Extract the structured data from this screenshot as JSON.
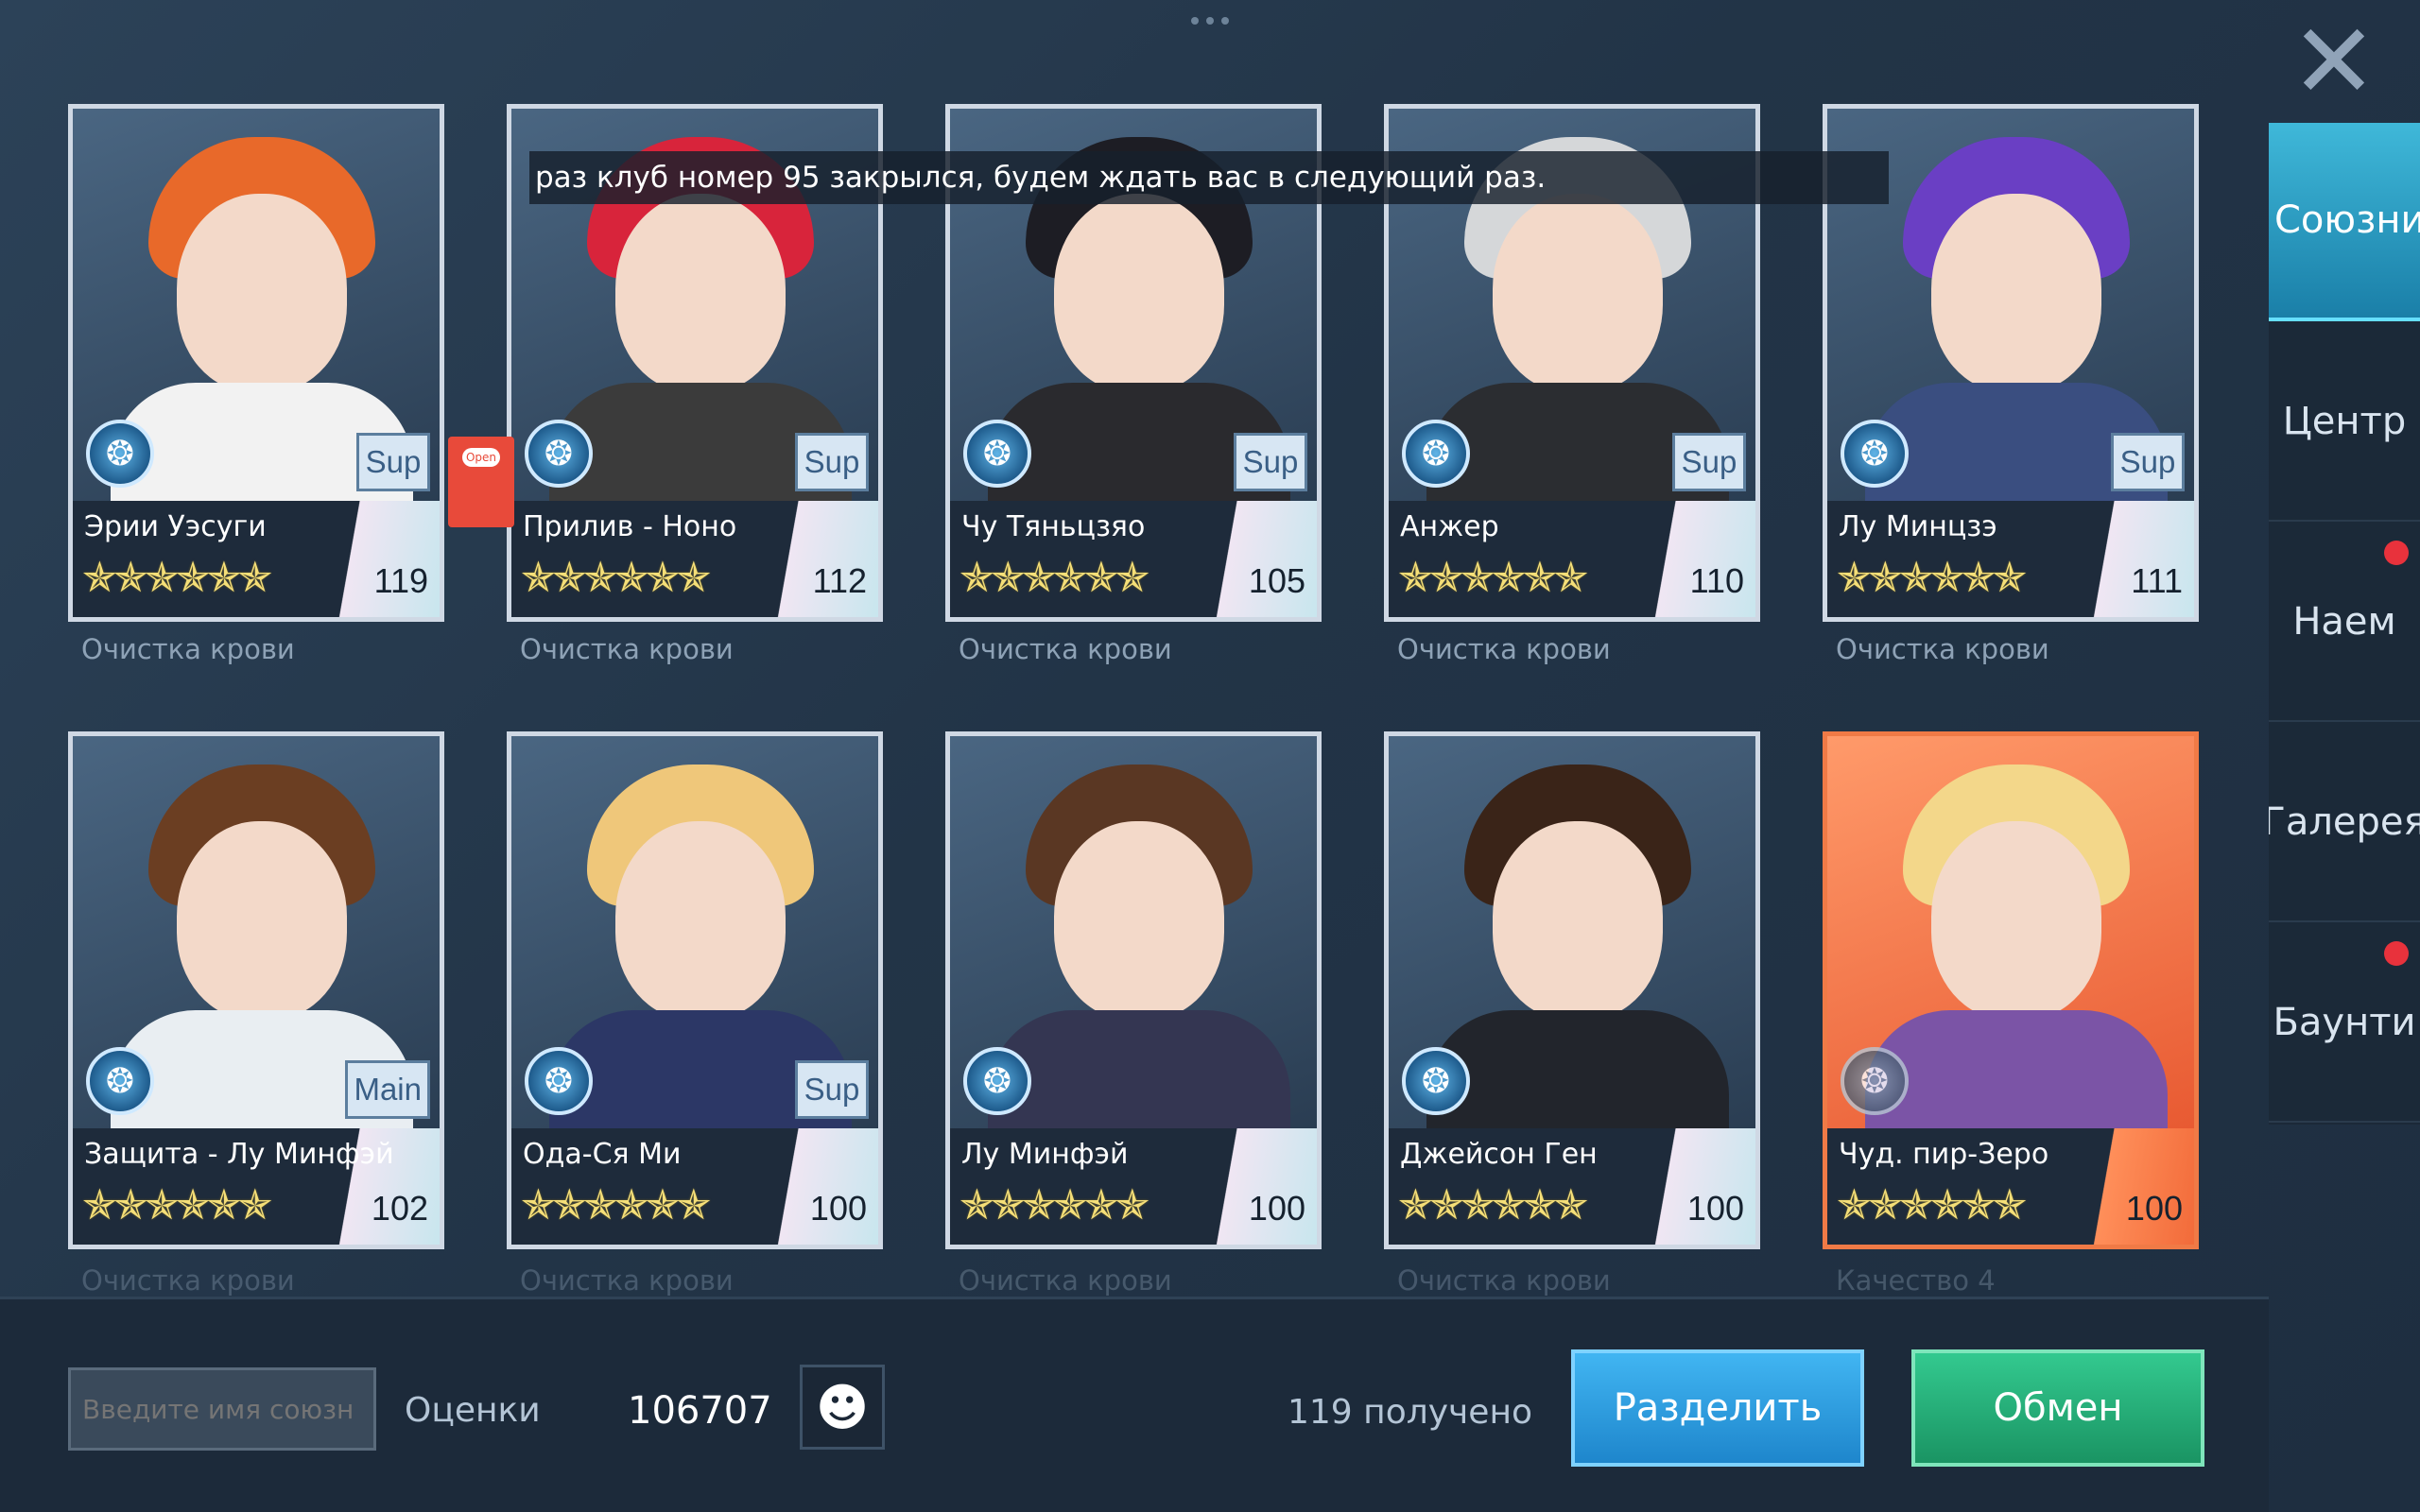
{
  "banner": "раз клуб номер 95 закрылся, будем ждать вас в следующий раз.",
  "close_label": "✕",
  "sidebar": {
    "items": [
      {
        "label": "Союзник",
        "active": true,
        "dot": false
      },
      {
        "label": "Центр",
        "active": false,
        "dot": false
      },
      {
        "label": "Наем",
        "active": false,
        "dot": true
      },
      {
        "label": "Галерея",
        "active": false,
        "dot": false
      },
      {
        "label": "Баунти",
        "active": false,
        "dot": true
      }
    ]
  },
  "cards": [
    {
      "name": "Эрии Уэсуги",
      "stars": "✯✯✯✯✯✯",
      "level": "119",
      "role": "Sup",
      "subtitle": "Очистка крови",
      "hair": "#e8692a",
      "body": "#f2f2f2"
    },
    {
      "name": "Прилив - Ноно",
      "stars": "✯✯✯✯✯✯",
      "level": "112",
      "role": "Sup",
      "subtitle": "Очистка крови",
      "hair": "#d8243b",
      "body": "#3b3b3b"
    },
    {
      "name": "Чу Тяньцзяо",
      "stars": "✯✯✯✯✯✯",
      "level": "105",
      "role": "Sup",
      "subtitle": "Очистка крови",
      "hair": "#1d1d24",
      "body": "#2a2a2e"
    },
    {
      "name": "Анжер",
      "stars": "✯✯✯✯✯✯",
      "level": "110",
      "role": "Sup",
      "subtitle": "Очистка крови",
      "hair": "#d5d7d9",
      "body": "#2b2d31"
    },
    {
      "name": "Лу Минцзэ",
      "stars": "✯✯✯✯✯✯",
      "level": "111",
      "role": "Sup",
      "subtitle": "Очистка крови",
      "hair": "#6a3fc4",
      "body": "#3a4e80"
    },
    {
      "name": "Защита - Лу Минфэй",
      "stars": "✯✯✯✯✯✯",
      "level": "102",
      "role": "Main",
      "subtitle": "Очистка крови",
      "hair": "#6b3e22",
      "body": "#e9eef2"
    },
    {
      "name": "Ода-Ся Ми",
      "stars": "✯✯✯✯✯✯",
      "level": "100",
      "role": "Sup",
      "subtitle": "Очистка крови",
      "hair": "#efc77a",
      "body": "#2c3766"
    },
    {
      "name": "Лу Минфэй",
      "stars": "✯✯✯✯✯✯",
      "level": "100",
      "role": "",
      "subtitle": "Очистка крови",
      "hair": "#5a3723",
      "body": "#343652"
    },
    {
      "name": "Джейсон Ген",
      "stars": "✯✯✯✯✯✯",
      "level": "100",
      "role": "",
      "subtitle": "Очистка крови",
      "hair": "#3a2418",
      "body": "#22252c"
    },
    {
      "name": "Чуд. пир-Зеро",
      "stars": "✯✯✯✯✯✯",
      "level": "100",
      "role": "",
      "subtitle": "Качество 4",
      "hair": "#f3d78a",
      "body": "#7b54a6"
    }
  ],
  "bottom": {
    "search_placeholder": "Введите имя союзн",
    "score_label": "Оценки",
    "score_value": "106707",
    "received": "119 получено",
    "split_label": "Разделить",
    "exchange_label": "Обмен"
  },
  "colors": {
    "accent": "#3fb8d9",
    "split": "#1e86cc",
    "exchange": "#1a9463",
    "notification_dot": "#e8323c"
  }
}
